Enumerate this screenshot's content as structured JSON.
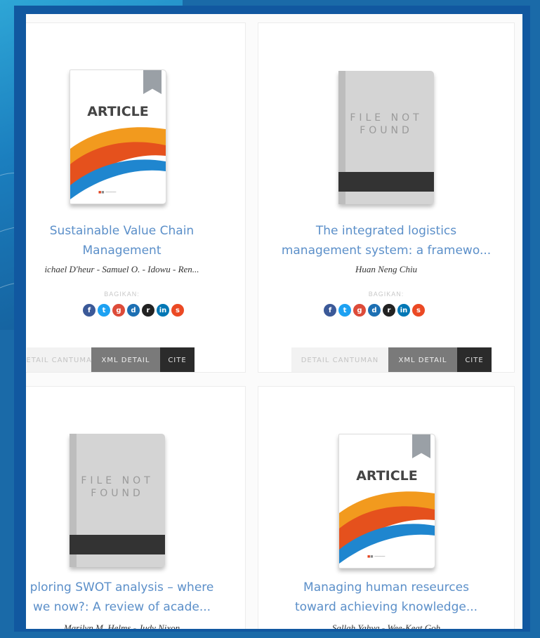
{
  "share_label": "BAGIKAN:",
  "buttons": {
    "detail": "DETAIL CANTUMAN",
    "xml": "XML DETAIL",
    "cite": "CITE"
  },
  "cover_texts": {
    "article": "ARTICLE",
    "not_found": "FILE NOT\nFOUND"
  },
  "share_icons": [
    {
      "name": "facebook-icon",
      "glyph": "f",
      "color": "#3b5998"
    },
    {
      "name": "twitter-icon",
      "glyph": "t",
      "color": "#1da1f2"
    },
    {
      "name": "google-plus-icon",
      "glyph": "g",
      "color": "#dd4b39"
    },
    {
      "name": "digg-icon",
      "glyph": "d",
      "color": "#1c6fb3"
    },
    {
      "name": "reddit-icon",
      "glyph": "r",
      "color": "#222222"
    },
    {
      "name": "linkedin-icon",
      "glyph": "in",
      "color": "#0077b5"
    },
    {
      "name": "stumbleupon-icon",
      "glyph": "s",
      "color": "#eb4924"
    }
  ],
  "items": [
    {
      "cover": "article",
      "title_lines": [
        "Sustainable Value Chain",
        "Management"
      ],
      "authors": "ichael D'heur - Samuel O. - Idowu - Ren..."
    },
    {
      "cover": "not_found",
      "title_lines": [
        "The integrated logistics",
        "management system: a framewo..."
      ],
      "authors": "Huan Neng Chiu"
    },
    {
      "cover": "not_found",
      "title_lines": [
        "ploring SWOT analysis – where",
        "we now?: A review of acade..."
      ],
      "authors": "Marilyn M. Helms - Judy Nixon"
    },
    {
      "cover": "article",
      "title_lines": [
        "Managing human reseurces",
        "toward achieving knowledge..."
      ],
      "authors": "Sallah Yahya - Wee-Keat Goh"
    }
  ]
}
